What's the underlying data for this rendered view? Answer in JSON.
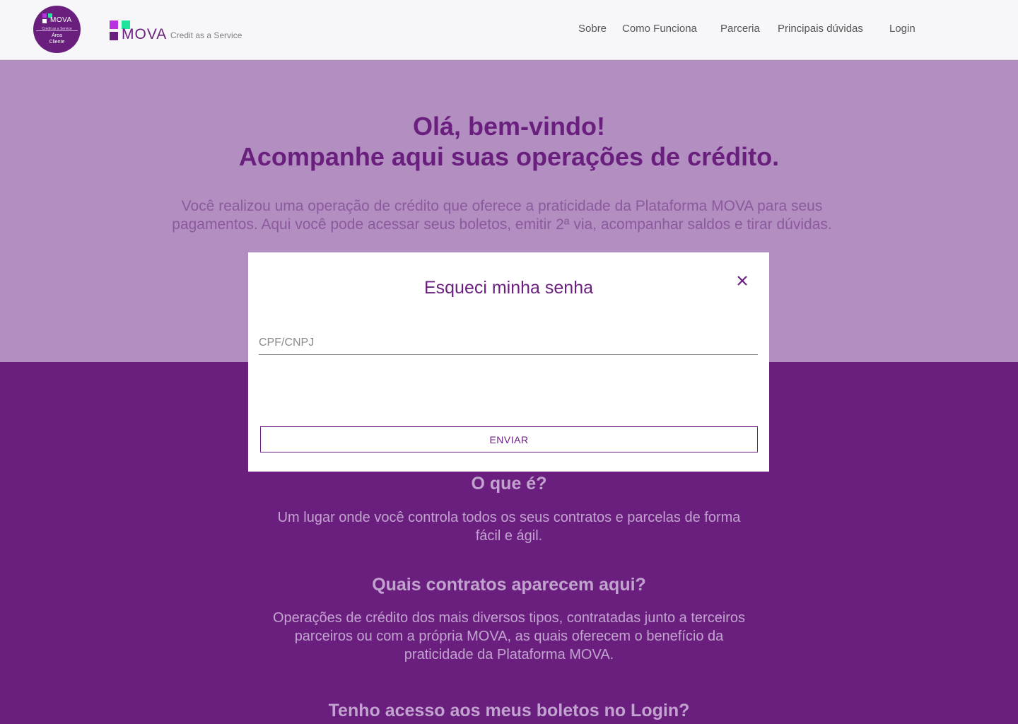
{
  "header": {
    "badge": {
      "brand": "MOVA",
      "tagline": "Credit as a Service",
      "area_line1": "Área",
      "area_line2": "Cliente"
    },
    "logo": {
      "brand": "MOVA",
      "tagline": "Credit as a Service"
    },
    "nav": [
      "Sobre",
      "Como Funciona",
      "Parceria",
      "Principais dúvidas",
      "Login"
    ]
  },
  "hero": {
    "title_line1": "Olá, bem-vindo!",
    "title_line2": "Acompanhe aqui suas operações de crédito.",
    "description": "Você realizou uma operação de crédito que oferece a praticidade da Plataforma MOVA para seus pagamentos. Aqui você pode acessar seus boletos, emitir 2ª via, acompanhar saldos e tirar dúvidas."
  },
  "content": {
    "q1": "O que é?",
    "a1": "Um lugar onde você controla todos os seus contratos e parcelas de forma fácil e ágil.",
    "q2": "Quais contratos aparecem aqui?",
    "a2": "Operações de crédito dos mais diversos tipos, contratadas junto a terceiros parceiros ou com a própria MOVA, as quais oferecem o benefício da praticidade da Plataforma MOVA.",
    "q3": "Tenho acesso aos meus boletos no Login?"
  },
  "modal": {
    "title": "Esqueci minha senha",
    "field_placeholder": "CPF/CNPJ",
    "field_value": "",
    "submit_label": "ENVIAR"
  },
  "colors": {
    "brand_purple": "#6a1f7e",
    "hero_bg": "#b38ec1",
    "accent_magenta": "#b832e0",
    "accent_green": "#1ee39a"
  },
  "icons": {
    "close": "close-icon",
    "logo_squares": "logo-squares-icon"
  }
}
